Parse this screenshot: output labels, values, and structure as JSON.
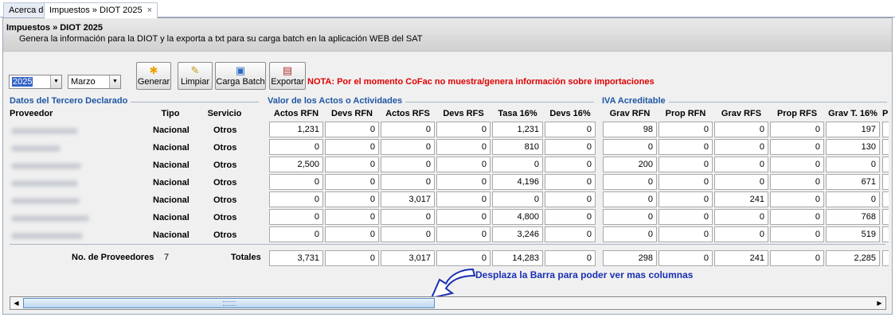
{
  "tabs": [
    {
      "label": "Acerca de"
    },
    {
      "label": "Impuestos » DIOT 2025",
      "close": "×"
    }
  ],
  "header": {
    "title": "Impuestos » DIOT 2025",
    "subtitle": "Genera la información para la DIOT y la exporta a txt para su carga batch en la aplicación WEB del SAT"
  },
  "toolbar": {
    "year": "2025",
    "month": "Marzo",
    "generar": "Generar",
    "limpiar": "Limpiar",
    "carga_batch": "Carga Batch",
    "exportar": "Exportar",
    "nota": "NOTA: Por el momento CoFac no muestra/genera información sobre importaciones"
  },
  "sections": {
    "tercero": "Datos del Tercero Declarado",
    "actos": "Valor de los Actos o Actividades",
    "iva": "IVA Acreditable"
  },
  "columns": [
    "Proveedor",
    "Tipo",
    "Servicio",
    "Actos RFN",
    "Devs RFN",
    "Actos RFS",
    "Devs RFS",
    "Tasa 16%",
    "Devs 16%",
    "Grav RFN",
    "Prop RFN",
    "Grav RFS",
    "Prop RFS",
    "Grav T. 16%",
    "P"
  ],
  "rows": [
    {
      "tipo": "Nacional",
      "servicio": "Otros",
      "v": [
        "1,231",
        "0",
        "0",
        "0",
        "1,231",
        "0",
        "98",
        "0",
        "0",
        "0",
        "197"
      ]
    },
    {
      "tipo": "Nacional",
      "servicio": "Otros",
      "v": [
        "0",
        "0",
        "0",
        "0",
        "810",
        "0",
        "0",
        "0",
        "0",
        "0",
        "130"
      ]
    },
    {
      "tipo": "Nacional",
      "servicio": "Otros",
      "v": [
        "2,500",
        "0",
        "0",
        "0",
        "0",
        "0",
        "200",
        "0",
        "0",
        "0",
        "0"
      ]
    },
    {
      "tipo": "Nacional",
      "servicio": "Otros",
      "v": [
        "0",
        "0",
        "0",
        "0",
        "4,196",
        "0",
        "0",
        "0",
        "0",
        "0",
        "671"
      ]
    },
    {
      "tipo": "Nacional",
      "servicio": "Otros",
      "v": [
        "0",
        "0",
        "3,017",
        "0",
        "0",
        "0",
        "0",
        "0",
        "241",
        "0",
        "0"
      ]
    },
    {
      "tipo": "Nacional",
      "servicio": "Otros",
      "v": [
        "0",
        "0",
        "0",
        "0",
        "4,800",
        "0",
        "0",
        "0",
        "0",
        "0",
        "768"
      ]
    },
    {
      "tipo": "Nacional",
      "servicio": "Otros",
      "v": [
        "0",
        "0",
        "0",
        "0",
        "3,246",
        "0",
        "0",
        "0",
        "0",
        "0",
        "519"
      ]
    }
  ],
  "totals": {
    "proveedores_label": "No. de Proveedores",
    "proveedores_count": "7",
    "totales_label": "Totales",
    "v": [
      "3,731",
      "0",
      "3,017",
      "0",
      "14,283",
      "0",
      "298",
      "0",
      "241",
      "0",
      "2,285"
    ]
  },
  "hint": "Desplaza la Barra para poder ver mas columnas",
  "scrollbar": {
    "position": 0.0,
    "visible_fraction": 0.48
  },
  "colors": {
    "section": "#1f57a4",
    "nota": "#e00000",
    "hint": "#1a2fb3"
  },
  "icons": [
    "generar-icon",
    "limpiar-icon",
    "save-icon",
    "exportar-icon",
    "scroll-left-icon",
    "scroll-right-icon",
    "arrow-pointer-icon"
  ]
}
